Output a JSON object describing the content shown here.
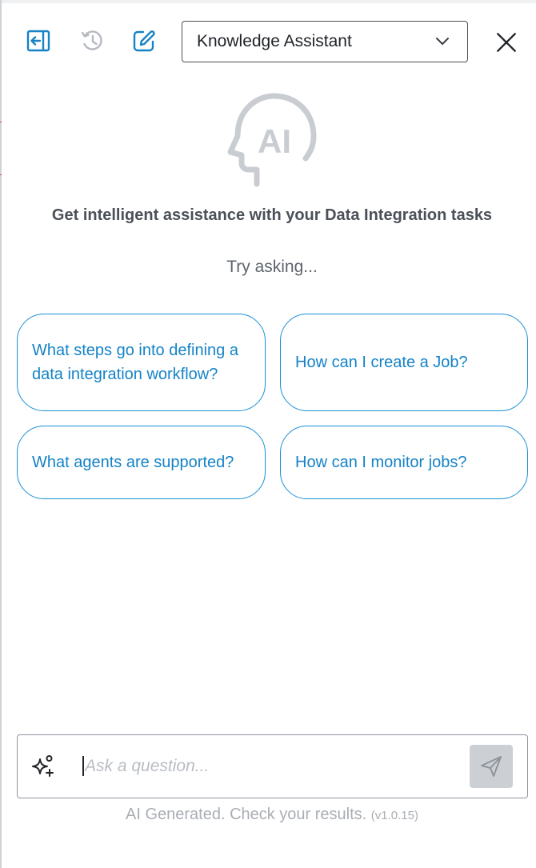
{
  "header": {
    "collapse_icon": "collapse-panel-icon",
    "history_icon": "history-icon",
    "new_chat_icon": "edit-icon",
    "close_icon": "close-icon",
    "assistant_selector": {
      "selected": "Knowledge Assistant",
      "icon": "chevron-down-icon"
    }
  },
  "hero": {
    "logo_text": "AI",
    "headline": "Get intelligent assistance with your Data Integration tasks",
    "try_asking": "Try asking..."
  },
  "suggestions": [
    {
      "label": "What steps go into defining a data integration workflow?"
    },
    {
      "label": "How can I create a Job?"
    },
    {
      "label": "What agents are supported?"
    },
    {
      "label": "How can I monitor jobs?"
    }
  ],
  "composer": {
    "placeholder": "Ask a question...",
    "value": "",
    "sparkle_icon": "sparkle-icon",
    "send_icon": "send-icon"
  },
  "footer": {
    "disclaimer": "AI Generated. Check your results.",
    "version": "(v1.0.15)"
  },
  "colors": {
    "accent": "#1583c6",
    "border_accent": "#1a8fd6",
    "text": "#4b5058",
    "muted": "#a9aeb4",
    "send_disabled": "#ccd0d4"
  }
}
